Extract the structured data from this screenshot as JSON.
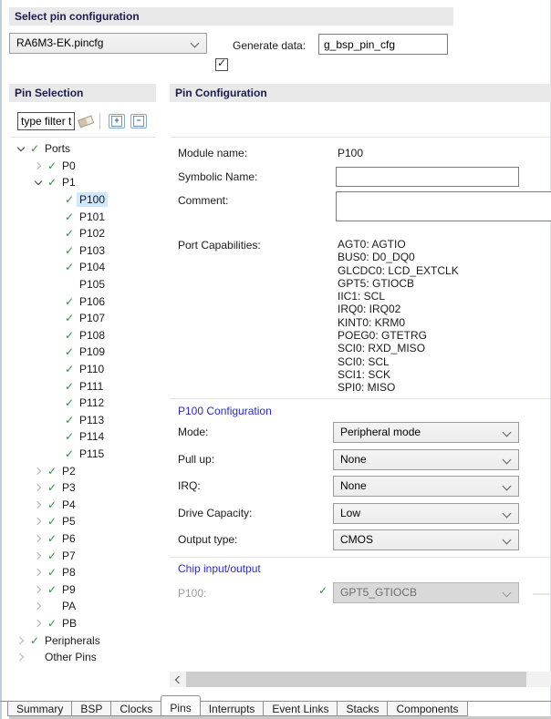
{
  "select_pin_configuration": {
    "title": "Select pin configuration",
    "device_dropdown_value": "RA6M3-EK.pincfg",
    "generate_data": {
      "label": "Generate data:",
      "checked": true,
      "value": "g_bsp_pin_cfg"
    }
  },
  "pin_selection": {
    "title": "Pin Selection",
    "filter_text": "type filter t",
    "toolbar": {
      "expand_all_glyph": "+",
      "collapse_all_glyph": "−"
    },
    "tree": [
      {
        "label": "Ports",
        "level": 0,
        "expander": "expanded",
        "checked": true
      },
      {
        "label": "P0",
        "level": 1,
        "expander": "collapsed",
        "checked": true
      },
      {
        "label": "P1",
        "level": 1,
        "expander": "expanded",
        "checked": true
      },
      {
        "label": "P100",
        "level": 2,
        "expander": null,
        "checked": true,
        "selected": true
      },
      {
        "label": "P101",
        "level": 2,
        "expander": null,
        "checked": true
      },
      {
        "label": "P102",
        "level": 2,
        "expander": null,
        "checked": true
      },
      {
        "label": "P103",
        "level": 2,
        "expander": null,
        "checked": true
      },
      {
        "label": "P104",
        "level": 2,
        "expander": null,
        "checked": true
      },
      {
        "label": "P105",
        "level": 2,
        "expander": null,
        "checked": false
      },
      {
        "label": "P106",
        "level": 2,
        "expander": null,
        "checked": true
      },
      {
        "label": "P107",
        "level": 2,
        "expander": null,
        "checked": true
      },
      {
        "label": "P108",
        "level": 2,
        "expander": null,
        "checked": true
      },
      {
        "label": "P109",
        "level": 2,
        "expander": null,
        "checked": true
      },
      {
        "label": "P110",
        "level": 2,
        "expander": null,
        "checked": true
      },
      {
        "label": "P111",
        "level": 2,
        "expander": null,
        "checked": true
      },
      {
        "label": "P112",
        "level": 2,
        "expander": null,
        "checked": true
      },
      {
        "label": "P113",
        "level": 2,
        "expander": null,
        "checked": true
      },
      {
        "label": "P114",
        "level": 2,
        "expander": null,
        "checked": true
      },
      {
        "label": "P115",
        "level": 2,
        "expander": null,
        "checked": true
      },
      {
        "label": "P2",
        "level": 1,
        "expander": "collapsed",
        "checked": true
      },
      {
        "label": "P3",
        "level": 1,
        "expander": "collapsed",
        "checked": true
      },
      {
        "label": "P4",
        "level": 1,
        "expander": "collapsed",
        "checked": true
      },
      {
        "label": "P5",
        "level": 1,
        "expander": "collapsed",
        "checked": true
      },
      {
        "label": "P6",
        "level": 1,
        "expander": "collapsed",
        "checked": true
      },
      {
        "label": "P7",
        "level": 1,
        "expander": "collapsed",
        "checked": true
      },
      {
        "label": "P8",
        "level": 1,
        "expander": "collapsed",
        "checked": true
      },
      {
        "label": "P9",
        "level": 1,
        "expander": "collapsed",
        "checked": true
      },
      {
        "label": "PA",
        "level": 1,
        "expander": "collapsed",
        "checked": false
      },
      {
        "label": "PB",
        "level": 1,
        "expander": "collapsed",
        "checked": true
      },
      {
        "label": "Peripherals",
        "level": 0,
        "expander": "collapsed",
        "checked": true
      },
      {
        "label": "Other Pins",
        "level": 0,
        "expander": "collapsed",
        "checked": false
      }
    ]
  },
  "pin_configuration": {
    "title": "Pin Configuration",
    "module_name": {
      "label": "Module name:",
      "value": "P100"
    },
    "symbolic_name": {
      "label": "Symbolic Name:",
      "value": ""
    },
    "comment": {
      "label": "Comment:",
      "value": ""
    },
    "port_capabilities": {
      "label": "Port Capabilities:",
      "items": [
        "AGT0: AGTIO",
        "BUS0: D0_DQ0",
        "GLCDC0: LCD_EXTCLK",
        "GPT5: GTIOCB",
        "IIC1: SCL",
        "IRQ0: IRQ02",
        "KINT0: KRM0",
        "POEG0: GTETRG",
        "SCI0: RXD_MISO",
        "SCI0: SCL",
        "SCI1: SCK",
        "SPI0: MISO"
      ]
    },
    "pin_config_section": {
      "title": "P100 Configuration",
      "fields": [
        {
          "label": "Mode:",
          "value": "Peripheral mode"
        },
        {
          "label": "Pull up:",
          "value": "None"
        },
        {
          "label": "IRQ:",
          "value": "None"
        },
        {
          "label": "Drive Capacity:",
          "value": "Low"
        },
        {
          "label": "Output type:",
          "value": "CMOS"
        }
      ]
    },
    "chip_io_section": {
      "title": "Chip input/output",
      "rows": [
        {
          "label": "P100:",
          "value": "GPT5_GTIOCB",
          "checked": true,
          "enabled": false
        }
      ]
    }
  },
  "bottom_tabs": {
    "items": [
      "Summary",
      "BSP",
      "Clocks",
      "Pins",
      "Interrupts",
      "Event Links",
      "Stacks",
      "Components"
    ],
    "active": "Pins"
  },
  "colors": {
    "header_bg": "#e9e9e9",
    "header_text": "#1b1b4c",
    "section_heading": "#2a2ad0",
    "check_green": "#2e9440",
    "sel_highlight": "#cde8ff"
  }
}
